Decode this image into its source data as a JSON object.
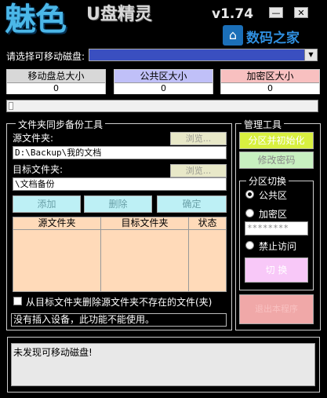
{
  "app": {
    "logo_main": "魅色",
    "logo_sub": "U盘精灵",
    "version": "v1.74",
    "brand_text": "数码之家"
  },
  "window_controls": {
    "minimize": "—",
    "close": "✕"
  },
  "disk_select": {
    "label": "请选择可移动磁盘:",
    "value": ""
  },
  "stats": [
    {
      "title": "移动盘总大小",
      "value": "0",
      "color": "#d8d8d8"
    },
    {
      "title": "公共区大小",
      "value": "0",
      "color": "#c0c0f8"
    },
    {
      "title": "加密区大小",
      "value": "0",
      "color": "#f8c0c0"
    }
  ],
  "backup": {
    "title": "文件夹同步备份工具",
    "source_label": "源文件夹:",
    "source_value": "D:\\Backup\\我的文档",
    "browse_label": "浏览...",
    "target_label": "目标文件夹:",
    "target_value": "\\文档备份",
    "add_label": "添加",
    "delete_label": "删除",
    "confirm_label": "确定",
    "columns": [
      "源文件夹",
      "目标文件夹",
      "状态"
    ],
    "checkbox_label": "从目标文件夹删除源文件夹不存在的文件(夹)",
    "status_text": "没有插入设备，此功能不能使用。"
  },
  "manage": {
    "title": "管理工具",
    "partition_init_label": "分区并初始化",
    "change_password_label": "修改密码",
    "switch_title": "分区切换",
    "public_label": "公共区",
    "encrypted_label": "加密区",
    "password_mask": "********",
    "forbid_label": "禁止访问",
    "switch_label": "切 换",
    "eject_label": "退出本程序"
  },
  "log": {
    "text": "未发现可移动磁盘!"
  }
}
